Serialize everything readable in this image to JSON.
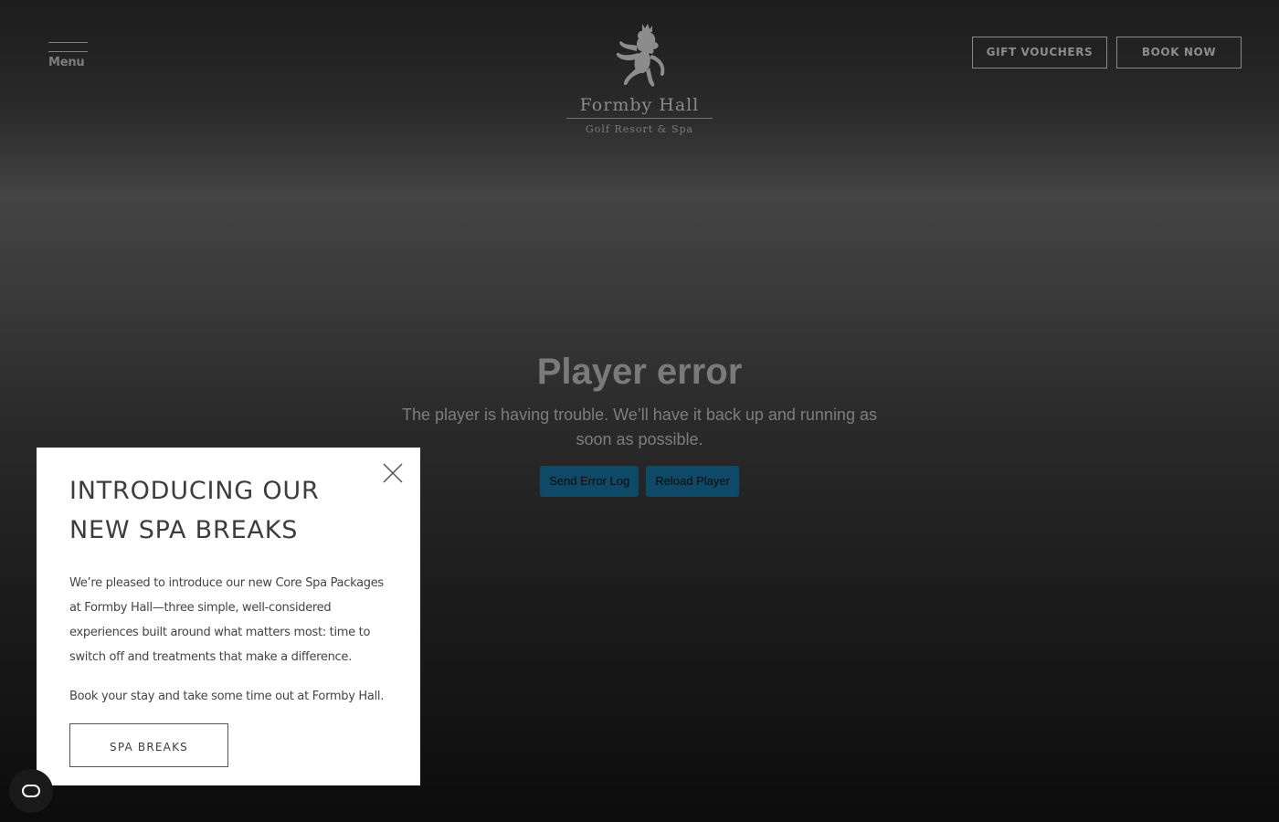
{
  "header": {
    "menu_label": "Menu",
    "logo": {
      "name": "Formby Hall",
      "tagline": "Golf Resort & Spa"
    },
    "gift_vouchers_label": "GIFT VOUCHERS",
    "book_now_label": "BOOK NOW"
  },
  "player_error": {
    "title": "Player error",
    "message": "The player is having trouble. We’ll have it back up and running as soon as possible.",
    "send_error_log_label": "Send Error Log",
    "reload_player_label": "Reload Player",
    "button_color": "#0e4a67"
  },
  "popup": {
    "heading": "INTRODUCING OUR NEW SPA BREAKS",
    "body": "We’re pleased to introduce our new Core Spa Packages at Formby Hall—three simple, well-considered experiences built around what matters most: time to switch off and treatments that make a difference.",
    "body2": "Book your stay and take some time out at Formby Hall.",
    "cta_label": "SPA BREAKS",
    "close_icon": "close-icon"
  },
  "accessibility": {
    "icon": "accessibility-icon"
  }
}
